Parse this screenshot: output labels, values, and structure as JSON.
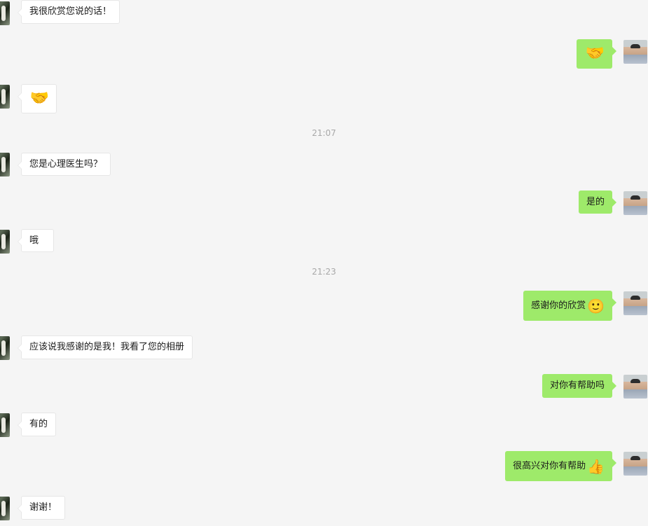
{
  "messages": [
    {
      "side": "left",
      "text": "我很欣赏您说的话！"
    },
    {
      "side": "right",
      "text": "",
      "emoji": "🤝"
    },
    {
      "side": "left",
      "text": "",
      "emoji": "🤝"
    },
    {
      "side": "time",
      "text": "21:07"
    },
    {
      "side": "left",
      "text": "您是心理医生吗？"
    },
    {
      "side": "right",
      "text": "是的"
    },
    {
      "side": "left",
      "text": "哦"
    },
    {
      "side": "time",
      "text": "21:23"
    },
    {
      "side": "right",
      "text": "感谢你的欣赏",
      "emoji": "🙂"
    },
    {
      "side": "left",
      "text": "应该说我感谢的是我！我看了您的相册"
    },
    {
      "side": "right",
      "text": "对你有帮助吗"
    },
    {
      "side": "left",
      "text": "有的"
    },
    {
      "side": "right",
      "text": "很高兴对你有帮助",
      "emoji": "👍"
    },
    {
      "side": "left",
      "text": "谢谢！"
    }
  ],
  "colors": {
    "background": "#f5f5f5",
    "bubble_right": "#9eea6a",
    "bubble_left": "#ffffff",
    "timestamp": "#a8a8a8"
  }
}
